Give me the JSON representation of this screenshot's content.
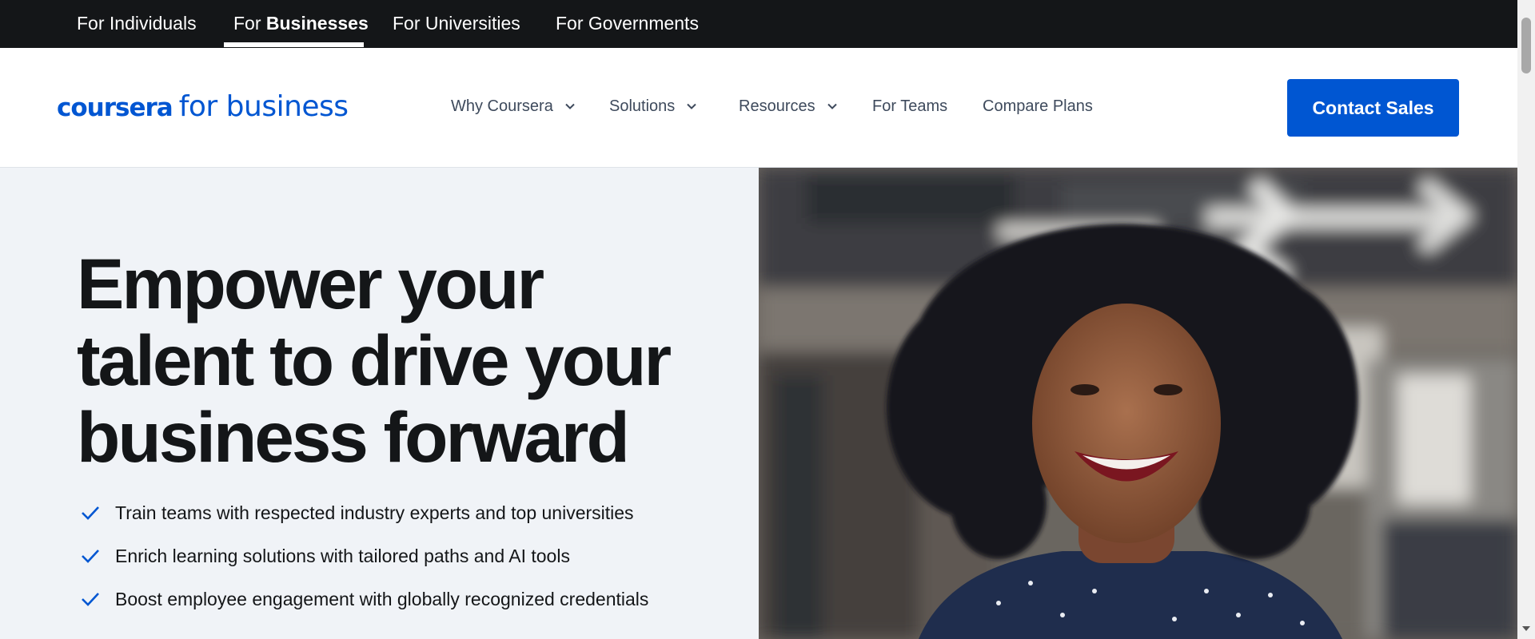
{
  "audience_tabs": {
    "individuals": "For Individuals",
    "businesses_prefix": "For ",
    "businesses_bold": "Businesses",
    "universities": "For Universities",
    "governments": "For Governments"
  },
  "brand": {
    "logo_word": "coursera",
    "logo_suffix": "for business",
    "color": "#0056d2"
  },
  "nav": {
    "why": "Why Coursera",
    "solutions": "Solutions",
    "resources": "Resources",
    "teams": "For Teams",
    "compare": "Compare Plans"
  },
  "cta": {
    "contact_sales": "Contact Sales"
  },
  "hero": {
    "title": "Empower your talent to drive your business forward",
    "benefits": [
      "Train teams with respected industry experts and top universities",
      "Enrich learning solutions with tailored paths and AI tools",
      "Boost employee engagement with globally recognized credentials"
    ]
  },
  "icons": {
    "check": "check-icon",
    "chevron": "chevron-down-icon"
  },
  "colors": {
    "top_bar": "#141618",
    "hero_background": "#f0f3f7",
    "accent": "#0056d2",
    "nav_text": "#3e4a5c"
  }
}
